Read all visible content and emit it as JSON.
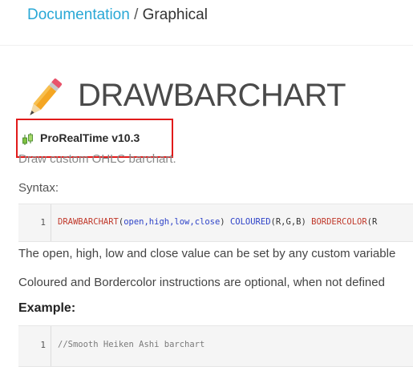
{
  "breadcrumb": {
    "link": "Documentation",
    "separator": "/",
    "current": "Graphical"
  },
  "page": {
    "title": "DRAWBARCHART",
    "icon": "pencil-icon"
  },
  "version": {
    "label": "ProRealTime v10.3",
    "icon": "candlestick-icon",
    "highlight_color": "#e11a1a"
  },
  "description": "Draw custom OHLC barchart.",
  "syntax": {
    "label": "Syntax:",
    "line_number": "1",
    "tokens": {
      "fn": "DRAWBARCHART",
      "open_paren": "(",
      "args": "open,high,low,close",
      "close_paren": ")",
      "coloured": "COLOURED",
      "coloured_args": "(R,G,B)",
      "bordercolor": "BORDERCOLOR",
      "bordercolor_args": "(R"
    }
  },
  "body": [
    "The open, high, low and close value can be set by any custom variable",
    "Coloured and Bordercolor instructions are optional, when not defined"
  ],
  "example": {
    "label": "Example:",
    "line_number": "1",
    "code": "//Smooth Heiken Ashi barchart"
  },
  "colors": {
    "link": "#29a8d6",
    "keyword_red": "#c0392b",
    "keyword_blue": "#2d42c8"
  }
}
